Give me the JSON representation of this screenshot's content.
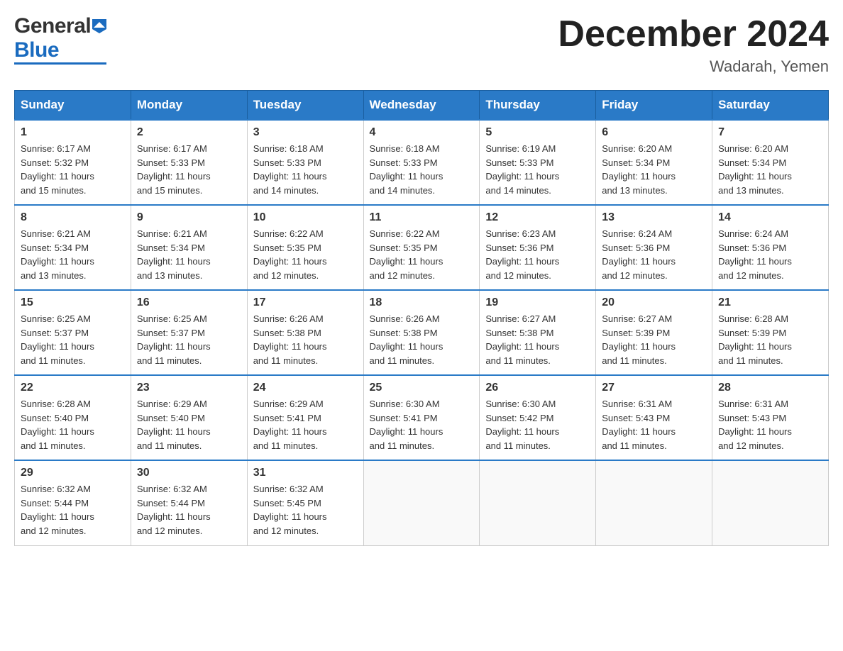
{
  "header": {
    "logo_general": "General",
    "logo_blue": "Blue",
    "month_year": "December 2024",
    "location": "Wadarah, Yemen"
  },
  "days_of_week": [
    "Sunday",
    "Monday",
    "Tuesday",
    "Wednesday",
    "Thursday",
    "Friday",
    "Saturday"
  ],
  "weeks": [
    [
      {
        "day": "1",
        "sunrise": "6:17 AM",
        "sunset": "5:32 PM",
        "daylight": "11 hours and 15 minutes."
      },
      {
        "day": "2",
        "sunrise": "6:17 AM",
        "sunset": "5:33 PM",
        "daylight": "11 hours and 15 minutes."
      },
      {
        "day": "3",
        "sunrise": "6:18 AM",
        "sunset": "5:33 PM",
        "daylight": "11 hours and 14 minutes."
      },
      {
        "day": "4",
        "sunrise": "6:18 AM",
        "sunset": "5:33 PM",
        "daylight": "11 hours and 14 minutes."
      },
      {
        "day": "5",
        "sunrise": "6:19 AM",
        "sunset": "5:33 PM",
        "daylight": "11 hours and 14 minutes."
      },
      {
        "day": "6",
        "sunrise": "6:20 AM",
        "sunset": "5:34 PM",
        "daylight": "11 hours and 13 minutes."
      },
      {
        "day": "7",
        "sunrise": "6:20 AM",
        "sunset": "5:34 PM",
        "daylight": "11 hours and 13 minutes."
      }
    ],
    [
      {
        "day": "8",
        "sunrise": "6:21 AM",
        "sunset": "5:34 PM",
        "daylight": "11 hours and 13 minutes."
      },
      {
        "day": "9",
        "sunrise": "6:21 AM",
        "sunset": "5:34 PM",
        "daylight": "11 hours and 13 minutes."
      },
      {
        "day": "10",
        "sunrise": "6:22 AM",
        "sunset": "5:35 PM",
        "daylight": "11 hours and 12 minutes."
      },
      {
        "day": "11",
        "sunrise": "6:22 AM",
        "sunset": "5:35 PM",
        "daylight": "11 hours and 12 minutes."
      },
      {
        "day": "12",
        "sunrise": "6:23 AM",
        "sunset": "5:36 PM",
        "daylight": "11 hours and 12 minutes."
      },
      {
        "day": "13",
        "sunrise": "6:24 AM",
        "sunset": "5:36 PM",
        "daylight": "11 hours and 12 minutes."
      },
      {
        "day": "14",
        "sunrise": "6:24 AM",
        "sunset": "5:36 PM",
        "daylight": "11 hours and 12 minutes."
      }
    ],
    [
      {
        "day": "15",
        "sunrise": "6:25 AM",
        "sunset": "5:37 PM",
        "daylight": "11 hours and 11 minutes."
      },
      {
        "day": "16",
        "sunrise": "6:25 AM",
        "sunset": "5:37 PM",
        "daylight": "11 hours and 11 minutes."
      },
      {
        "day": "17",
        "sunrise": "6:26 AM",
        "sunset": "5:38 PM",
        "daylight": "11 hours and 11 minutes."
      },
      {
        "day": "18",
        "sunrise": "6:26 AM",
        "sunset": "5:38 PM",
        "daylight": "11 hours and 11 minutes."
      },
      {
        "day": "19",
        "sunrise": "6:27 AM",
        "sunset": "5:38 PM",
        "daylight": "11 hours and 11 minutes."
      },
      {
        "day": "20",
        "sunrise": "6:27 AM",
        "sunset": "5:39 PM",
        "daylight": "11 hours and 11 minutes."
      },
      {
        "day": "21",
        "sunrise": "6:28 AM",
        "sunset": "5:39 PM",
        "daylight": "11 hours and 11 minutes."
      }
    ],
    [
      {
        "day": "22",
        "sunrise": "6:28 AM",
        "sunset": "5:40 PM",
        "daylight": "11 hours and 11 minutes."
      },
      {
        "day": "23",
        "sunrise": "6:29 AM",
        "sunset": "5:40 PM",
        "daylight": "11 hours and 11 minutes."
      },
      {
        "day": "24",
        "sunrise": "6:29 AM",
        "sunset": "5:41 PM",
        "daylight": "11 hours and 11 minutes."
      },
      {
        "day": "25",
        "sunrise": "6:30 AM",
        "sunset": "5:41 PM",
        "daylight": "11 hours and 11 minutes."
      },
      {
        "day": "26",
        "sunrise": "6:30 AM",
        "sunset": "5:42 PM",
        "daylight": "11 hours and 11 minutes."
      },
      {
        "day": "27",
        "sunrise": "6:31 AM",
        "sunset": "5:43 PM",
        "daylight": "11 hours and 11 minutes."
      },
      {
        "day": "28",
        "sunrise": "6:31 AM",
        "sunset": "5:43 PM",
        "daylight": "11 hours and 12 minutes."
      }
    ],
    [
      {
        "day": "29",
        "sunrise": "6:32 AM",
        "sunset": "5:44 PM",
        "daylight": "11 hours and 12 minutes."
      },
      {
        "day": "30",
        "sunrise": "6:32 AM",
        "sunset": "5:44 PM",
        "daylight": "11 hours and 12 minutes."
      },
      {
        "day": "31",
        "sunrise": "6:32 AM",
        "sunset": "5:45 PM",
        "daylight": "11 hours and 12 minutes."
      },
      null,
      null,
      null,
      null
    ]
  ],
  "labels": {
    "sunrise": "Sunrise:",
    "sunset": "Sunset:",
    "daylight": "Daylight:"
  }
}
